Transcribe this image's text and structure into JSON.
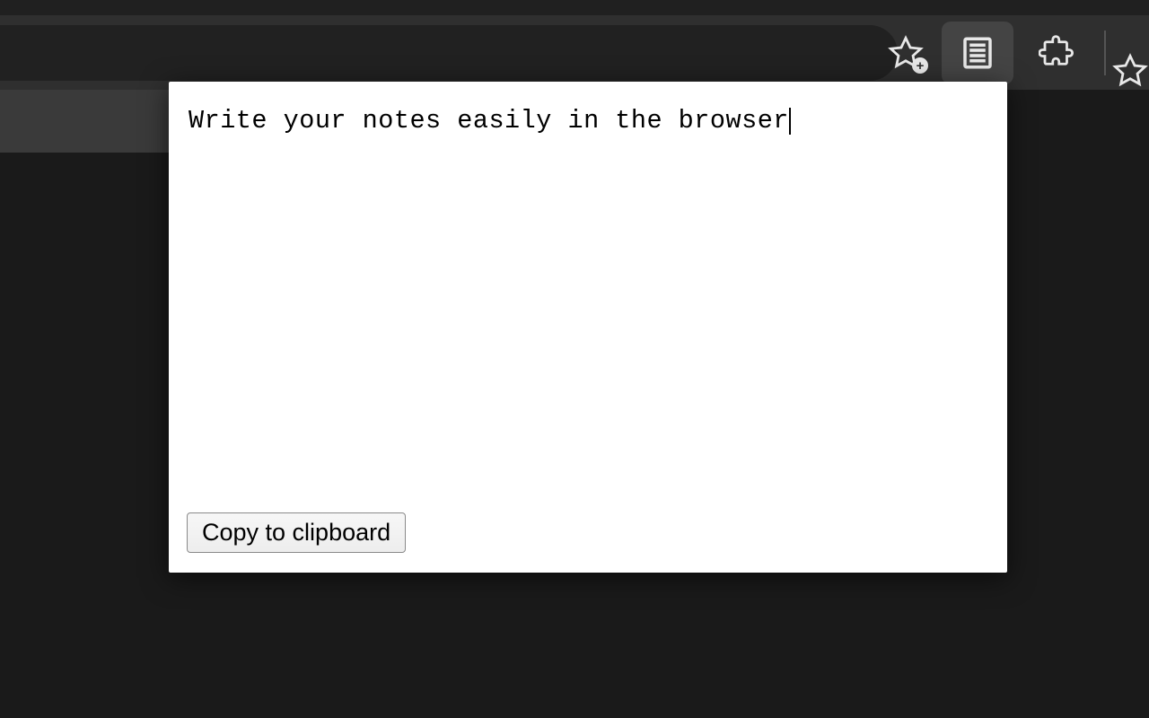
{
  "toolbar": {
    "icons": {
      "bookmark_add": "star-add-icon",
      "notes": "notes-icon",
      "extensions": "puzzle-icon",
      "favorite": "star-icon"
    }
  },
  "popup": {
    "note_text": "Write your notes easily in the browser",
    "copy_button_label": "Copy to clipboard"
  }
}
